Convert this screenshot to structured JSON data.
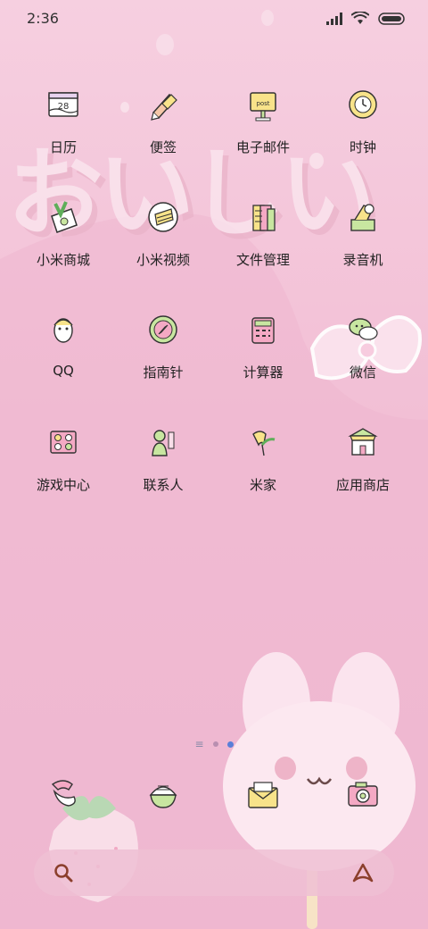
{
  "status_bar": {
    "time": "2:36"
  },
  "apps": [
    {
      "label": "日历",
      "icon": "calendar-icon"
    },
    {
      "label": "便签",
      "icon": "notes-icon"
    },
    {
      "label": "电子邮件",
      "icon": "email-icon"
    },
    {
      "label": "时钟",
      "icon": "clock-icon"
    },
    {
      "label": "小米商城",
      "icon": "mi-store-icon"
    },
    {
      "label": "小米视频",
      "icon": "mi-video-icon"
    },
    {
      "label": "文件管理",
      "icon": "file-manager-icon"
    },
    {
      "label": "录音机",
      "icon": "recorder-icon"
    },
    {
      "label": "QQ",
      "icon": "qq-icon"
    },
    {
      "label": "指南针",
      "icon": "compass-icon"
    },
    {
      "label": "计算器",
      "icon": "calculator-icon"
    },
    {
      "label": "微信",
      "icon": "wechat-icon"
    },
    {
      "label": "游戏中心",
      "icon": "game-center-icon"
    },
    {
      "label": "联系人",
      "icon": "contacts-icon"
    },
    {
      "label": "米家",
      "icon": "mijia-icon"
    },
    {
      "label": "应用商店",
      "icon": "app-store-icon"
    }
  ],
  "calendar_icon_text": "28",
  "email_icon_text": "post",
  "dock": [
    {
      "icon": "phone-icon"
    },
    {
      "icon": "browser-icon"
    },
    {
      "icon": "messages-icon"
    },
    {
      "icon": "camera-icon"
    }
  ],
  "page_indicator": {
    "count": 2,
    "active": 1
  },
  "wallpaper_text": "おいしい",
  "colors": {
    "background": "#f4c6da",
    "accent": "#5a7fd8",
    "icon_green": "#c8e6a0",
    "icon_yellow": "#f8e38a"
  }
}
